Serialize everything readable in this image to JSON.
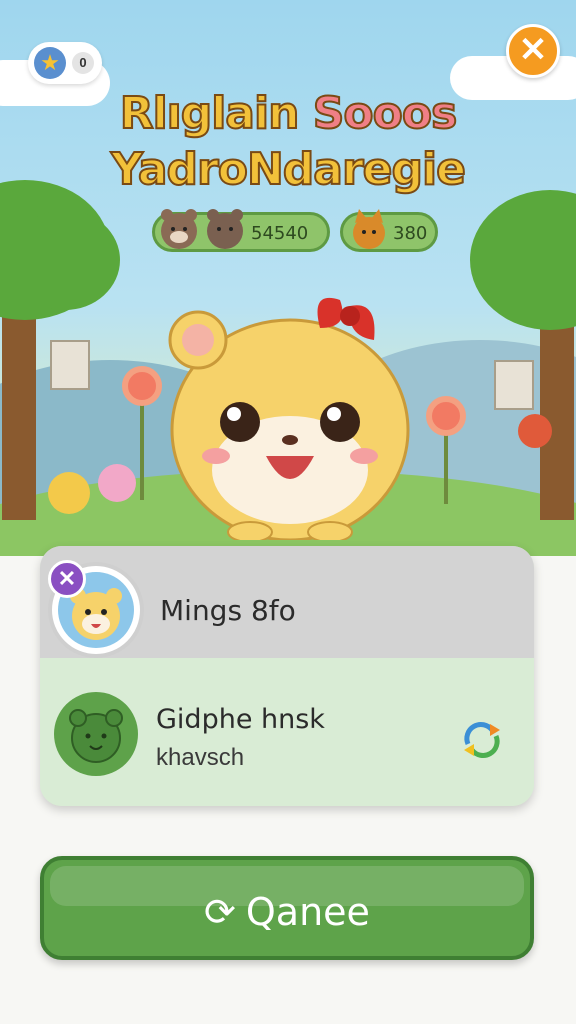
{
  "hud": {
    "star_count": "0",
    "close_symbol": "✕"
  },
  "title": {
    "line1_main": "Rlıglain ",
    "line1_pink": "Sooos",
    "line2": "YadroNdaregie"
  },
  "stats": {
    "left_value": "54540",
    "right_value": "380"
  },
  "card": {
    "row1": {
      "name": "Mings 8fo",
      "remove_symbol": "✕"
    },
    "row2": {
      "name": "Gidphe hnsk",
      "subtitle": "khavsch"
    }
  },
  "cta": {
    "icon": "⟳",
    "label": "Qanee"
  },
  "colors": {
    "accent_orange": "#f59b20",
    "primary_green": "#5ea34a",
    "badge_purple": "#8a4fc2"
  },
  "icons": [
    "star-icon",
    "close-icon",
    "bear-icon",
    "cat-icon",
    "sync-icon",
    "link-icon"
  ]
}
